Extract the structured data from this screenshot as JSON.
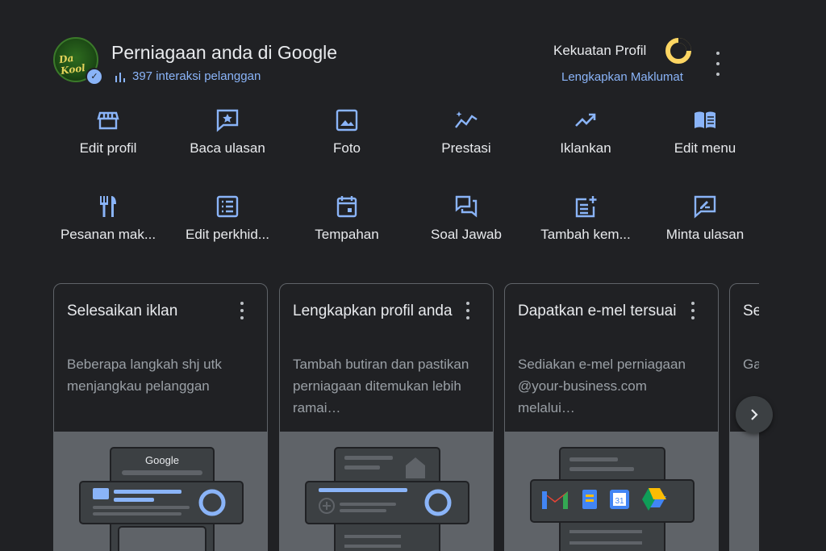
{
  "header": {
    "logo_text": "Da Kool",
    "title": "Perniagaan anda di Google",
    "interactions": "397 interaksi pelanggan",
    "strength_label": "Kekuatan Profil",
    "complete_link": "Lengkapkan Maklumat"
  },
  "actions_row1": [
    {
      "label": "Edit profil",
      "icon": "store-icon"
    },
    {
      "label": "Baca ulasan",
      "icon": "star-review-icon"
    },
    {
      "label": "Foto",
      "icon": "photo-icon"
    },
    {
      "label": "Prestasi",
      "icon": "sparkline-icon"
    },
    {
      "label": "Iklankan",
      "icon": "trending-up-icon"
    },
    {
      "label": "Edit menu",
      "icon": "menu-book-icon"
    }
  ],
  "actions_row2": [
    {
      "label": "Pesanan mak...",
      "icon": "restaurant-icon"
    },
    {
      "label": "Edit perkhid...",
      "icon": "list-icon"
    },
    {
      "label": "Tempahan",
      "icon": "calendar-icon"
    },
    {
      "label": "Soal Jawab",
      "icon": "forum-icon"
    },
    {
      "label": "Tambah kem...",
      "icon": "post-add-icon"
    },
    {
      "label": "Minta ulasan",
      "icon": "rate-review-icon"
    }
  ],
  "cards": [
    {
      "title": "Selesaikan iklan",
      "desc": "Beberapa langkah shj utk menjangkau pelanggan",
      "illu_text": "Google"
    },
    {
      "title": "Lengkapkan profil anda",
      "desc": "Tambah butiran dan pastikan perniagaan ditemukan lebih ramai…"
    },
    {
      "title": "Dapatkan e-mel tersuai",
      "desc": "Sediakan e-mel perniagaan @your-business.com melalui…",
      "calendar_day": "31"
    },
    {
      "title": "Se te",
      "desc": "Ga me"
    }
  ],
  "colors": {
    "accent": "#8ab4f8",
    "background": "#202124",
    "card_border": "#5f6368"
  }
}
